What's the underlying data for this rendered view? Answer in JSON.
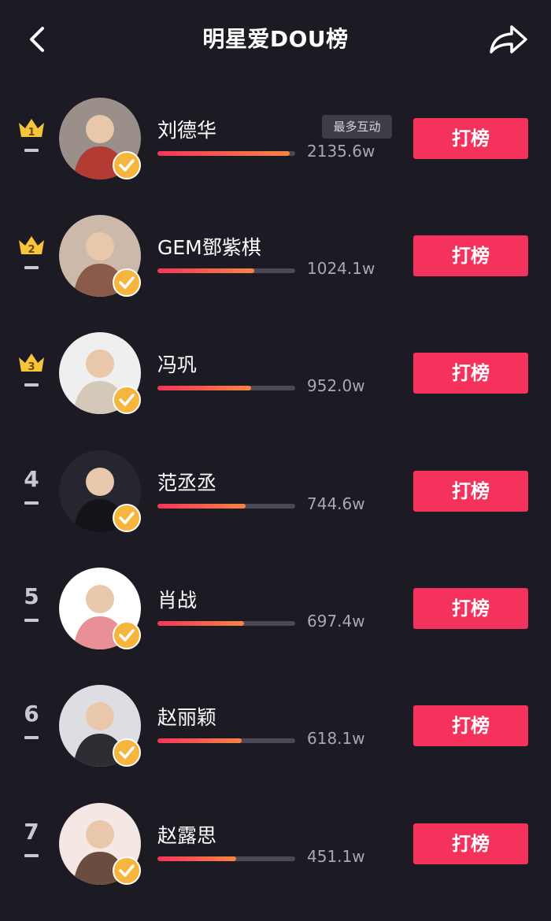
{
  "header": {
    "title": "明星爱DOU榜",
    "back_icon": "chevron-left-icon",
    "share_icon": "share-arrow-icon"
  },
  "colors": {
    "background": "#1c1b24",
    "accent": "#f5325c",
    "crown": "#f6c53b",
    "verified": "#f6b53d"
  },
  "badge_label": "最多互动",
  "items": [
    {
      "rank": "1",
      "crown": true,
      "name": "刘德华",
      "value": "2135.6w",
      "progress": 0.96,
      "button": "打榜",
      "avatar_bg": "#9b8f89",
      "avatar_fg": "#b23b34"
    },
    {
      "rank": "2",
      "crown": true,
      "name": "GEM鄧紫棋",
      "value": "1024.1w",
      "progress": 0.7,
      "button": "打榜",
      "avatar_bg": "#cdb9a9",
      "avatar_fg": "#8a5a4a"
    },
    {
      "rank": "3",
      "crown": true,
      "name": "冯巩",
      "value": "952.0w",
      "progress": 0.68,
      "button": "打榜",
      "avatar_bg": "#efefef",
      "avatar_fg": "#d4c8b8"
    },
    {
      "rank": "4",
      "crown": false,
      "name": "范丞丞",
      "value": "744.6w",
      "progress": 0.64,
      "button": "打榜",
      "avatar_bg": "#262630",
      "avatar_fg": "#141418"
    },
    {
      "rank": "5",
      "crown": false,
      "name": "肖战",
      "value": "697.4w",
      "progress": 0.63,
      "button": "打榜",
      "avatar_bg": "#ffffff",
      "avatar_fg": "#e98f97"
    },
    {
      "rank": "6",
      "crown": false,
      "name": "赵丽颖",
      "value": "618.1w",
      "progress": 0.61,
      "button": "打榜",
      "avatar_bg": "#dedee2",
      "avatar_fg": "#2d2d33"
    },
    {
      "rank": "7",
      "crown": false,
      "name": "赵露思",
      "value": "451.1w",
      "progress": 0.57,
      "button": "打榜",
      "avatar_bg": "#f4e7e4",
      "avatar_fg": "#6b4d40"
    }
  ]
}
